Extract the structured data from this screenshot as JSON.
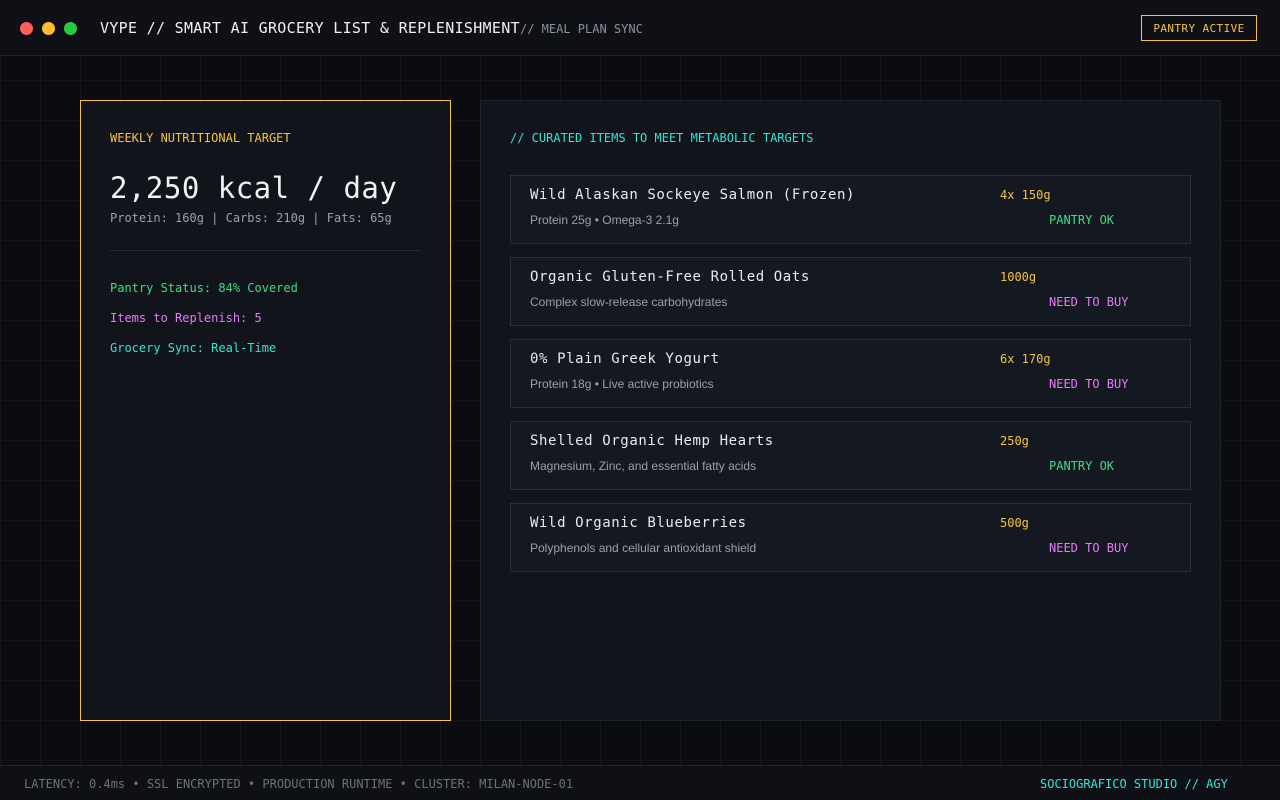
{
  "window": {
    "title": "VYPE // SMART AI GROCERY LIST & REPLENISHMENT",
    "subtitle": "// MEAL PLAN SYNC",
    "badge": "PANTRY ACTIVE"
  },
  "nutrition": {
    "label": "WEEKLY NUTRITIONAL TARGET",
    "kcal": "2,250 kcal / day",
    "macros": "Protein: 160g | Carbs: 210g | Fats: 65g",
    "pantry_status": "Pantry Status: 84% Covered",
    "items_to_replenish": "Items to Replenish: 5",
    "grocery_sync": "Grocery Sync: Real-Time"
  },
  "curated": {
    "label": "// CURATED ITEMS TO MEET METABOLIC TARGETS",
    "items": [
      {
        "name": "Wild Alaskan Sockeye Salmon (Frozen)",
        "desc": "Protein 25g • Omega-3 2.1g",
        "qty": "4x 150g",
        "status": "PANTRY OK"
      },
      {
        "name": "Organic Gluten-Free Rolled Oats",
        "desc": "Complex slow-release carbohydrates",
        "qty": "1000g",
        "status": "NEED TO BUY"
      },
      {
        "name": "0% Plain Greek Yogurt",
        "desc": "Protein 18g • Live active probiotics",
        "qty": "6x 170g",
        "status": "NEED TO BUY"
      },
      {
        "name": "Shelled Organic Hemp Hearts",
        "desc": "Magnesium, Zinc, and essential fatty acids",
        "qty": "250g",
        "status": "PANTRY OK"
      },
      {
        "name": "Wild Organic Blueberries",
        "desc": "Polyphenols and cellular antioxidant shield",
        "qty": "500g",
        "status": "NEED TO BUY"
      }
    ]
  },
  "footer": {
    "left": "LATENCY: 0.4ms • SSL ENCRYPTED • PRODUCTION RUNTIME • CLUSTER: MILAN-NODE-01",
    "right": "SOCIOGRAFICO STUDIO // AGY"
  },
  "colors": {
    "accent_yellow": "#f5c242",
    "accent_cyan": "#2ee6d6",
    "status_ok": "#3ddc84",
    "status_buy": "#e879f9"
  }
}
